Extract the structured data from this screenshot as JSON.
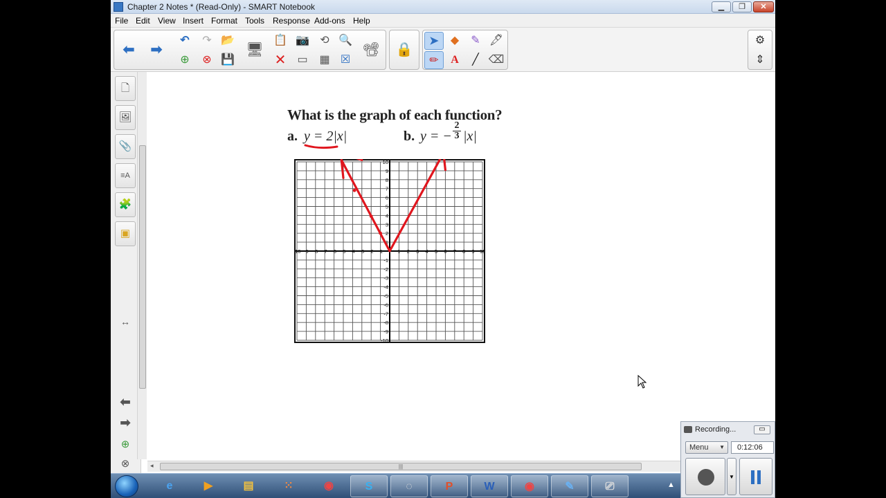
{
  "window": {
    "title": "Chapter 2 Notes * (Read-Only) - SMART Notebook"
  },
  "menu": [
    "File",
    "Edit",
    "View",
    "Insert",
    "Format",
    "Tools",
    "Response",
    "Add-ons",
    "Help"
  ],
  "page": {
    "question": "What is the graph of each function?",
    "part_a_label": "a.",
    "part_a_expr": "y = 2|x|",
    "part_b_label": "b.",
    "part_b_expr": "y = −",
    "part_b_frac_num": "2",
    "part_b_frac_den": "3",
    "part_b_tail": "|x|"
  },
  "grid": {
    "x_min": -10,
    "x_max": 10,
    "y_min": -10,
    "y_max": 10,
    "x_ticks": [
      "-10",
      "-9",
      "-8",
      "-7",
      "-6",
      "-5",
      "-4",
      "-3",
      "-2",
      "-1",
      "1",
      "2",
      "3",
      "4",
      "5",
      "6",
      "7",
      "8",
      "9",
      "10"
    ],
    "y_ticks_pos": [
      "1",
      "2",
      "3",
      "4",
      "5",
      "6",
      "7",
      "8",
      "9",
      "10"
    ],
    "y_ticks_neg": [
      "-1",
      "-2",
      "-3",
      "-4",
      "-5",
      "-6",
      "-7",
      "-8",
      "-9",
      "-10"
    ]
  },
  "recorder": {
    "title": "Recording...",
    "menu_label": "Menu",
    "time": "0:12:06"
  },
  "colors": {
    "ink": "#e0161e",
    "accent": "#2d6fc2"
  },
  "taskbar": {
    "items": [
      "ie-icon",
      "media-player-icon",
      "explorer-icon",
      "apps-icon",
      "chrome-icon",
      "skype-icon",
      "loading-icon",
      "powerpoint-icon",
      "word-icon",
      "chrome-icon",
      "notebook-icon",
      "recorder-icon"
    ]
  }
}
